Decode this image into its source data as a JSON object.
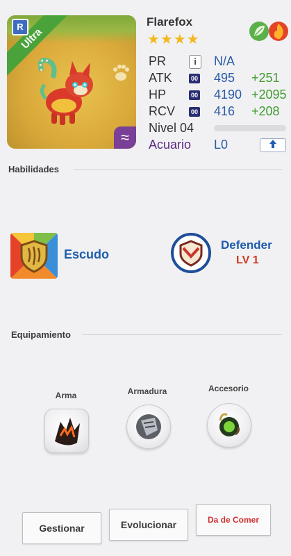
{
  "creature": {
    "name": "Flarefox",
    "rarity_ribbon": "Ultra",
    "rarity_badge": "R",
    "stars": "★★★★",
    "elements": [
      "leaf-icon",
      "fire-icon"
    ],
    "element_corner": "≈"
  },
  "stats": {
    "pr": {
      "label": "PR",
      "icon": "i",
      "value": "N/A"
    },
    "atk": {
      "label": "ATK",
      "icon": "00",
      "value": "495",
      "bonus": "+251"
    },
    "hp": {
      "label": "HP",
      "icon": "00",
      "value": "4190",
      "bonus": "+2095"
    },
    "rcv": {
      "label": "RCV",
      "icon": "00",
      "value": "416",
      "bonus": "+208"
    },
    "level": {
      "label": "Nivel 04",
      "progress": 0
    },
    "habitat": {
      "label": "Acuario",
      "value": "L0"
    }
  },
  "abilities": {
    "title": "Habilidades",
    "ability": {
      "name": "Escudo"
    },
    "trait": {
      "name": "Defender",
      "level": "LV 1"
    }
  },
  "equipment": {
    "title": "Equipamiento",
    "slots": [
      {
        "label": "Arma"
      },
      {
        "label": "Armadura"
      },
      {
        "label": "Accesorio"
      }
    ]
  },
  "buttons": {
    "manage": "Gestionar",
    "evolve": "Evolucionar",
    "feed": "Da de Comer"
  },
  "colors": {
    "accent_blue": "#1d5cab",
    "bonus_green": "#3f9b2e",
    "level_red": "#d0391e",
    "ribbon_green": "#4aa33a"
  }
}
